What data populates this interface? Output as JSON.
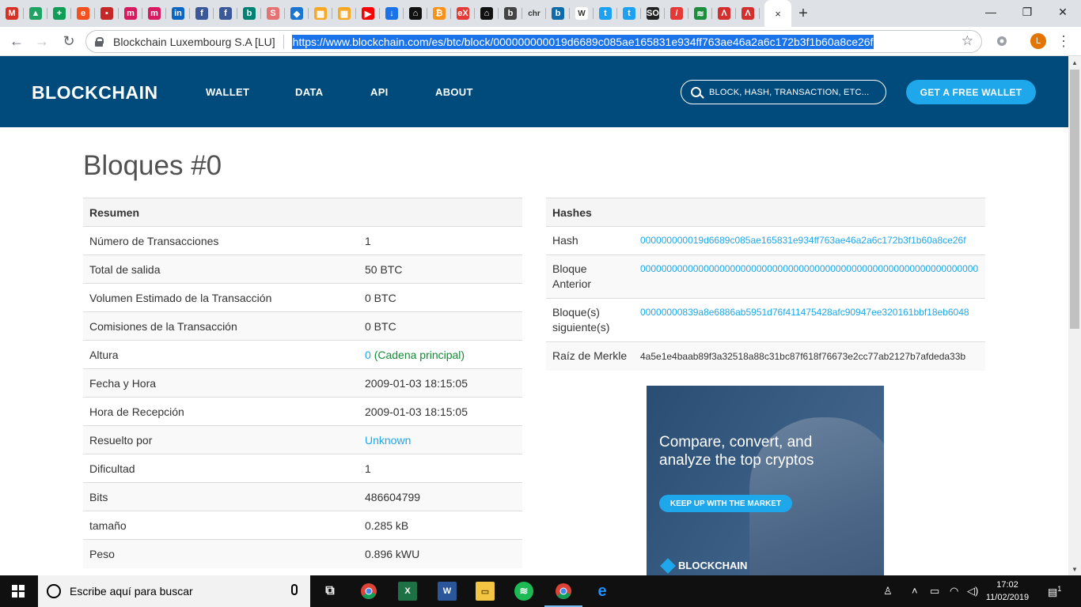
{
  "browser": {
    "active_tab_close": "×",
    "new_tab": "+",
    "site_identity": "Blockchain Luxembourg S.A [LU]",
    "url": "https://www.blockchain.com/es/btc/block/000000000019d6689c085ae165831e934ff763ae46a2a6c172b3f1b60a8ce26f",
    "profile_initial": "L",
    "bookmarks": [
      {
        "icon": "gmail-icon",
        "glyph": "M",
        "color": "#d93025"
      },
      {
        "icon": "drive-icon",
        "glyph": "▲",
        "color": "#1fa463"
      },
      {
        "icon": "sheets-plus-icon",
        "glyph": "+",
        "color": "#0f9d58"
      },
      {
        "icon": "e-icon",
        "glyph": "e",
        "color": "#f4511e"
      },
      {
        "icon": "grid-icon",
        "glyph": "▪",
        "color": "#c62828"
      },
      {
        "icon": "m-icon",
        "glyph": "m",
        "color": "#d81b60"
      },
      {
        "icon": "m-icon-2",
        "glyph": "m",
        "color": "#d81b60"
      },
      {
        "icon": "linkedin-icon",
        "glyph": "in",
        "color": "#0a66c2"
      },
      {
        "icon": "facebook-icon",
        "glyph": "f",
        "color": "#3b5998"
      },
      {
        "icon": "facebook-icon-2",
        "glyph": "f",
        "color": "#3b5998"
      },
      {
        "icon": "bing-icon",
        "glyph": "b",
        "color": "#008373"
      },
      {
        "icon": "s-icon",
        "glyph": "S",
        "color": "#e57373"
      },
      {
        "icon": "diamond-icon",
        "glyph": "◆",
        "color": "#1976d2"
      },
      {
        "icon": "table-icon",
        "glyph": "▦",
        "color": "#f9a825"
      },
      {
        "icon": "table-icon-2",
        "glyph": "▦",
        "color": "#f9a825"
      },
      {
        "icon": "youtube-icon",
        "glyph": "▶",
        "color": "#ff0000"
      },
      {
        "icon": "download-icon",
        "glyph": "↓",
        "color": "#1a73e8"
      },
      {
        "icon": "house-icon",
        "glyph": "⌂",
        "color": "#111111"
      },
      {
        "icon": "bitcoin-icon",
        "glyph": "₿",
        "color": "#f7931a"
      },
      {
        "icon": "xe-icon",
        "glyph": "eX",
        "color": "#e53935"
      },
      {
        "icon": "house-icon-2",
        "glyph": "⌂",
        "color": "#111111"
      },
      {
        "icon": "b-outline-icon",
        "glyph": "b",
        "color": "#444444"
      },
      {
        "icon": "chr-tab",
        "glyph": "chr",
        "color": "#dee1e6"
      },
      {
        "icon": "bing-icon-2",
        "glyph": "b",
        "color": "#0f6ca8"
      },
      {
        "icon": "wikipedia-icon",
        "glyph": "W",
        "color": "#ffffff"
      },
      {
        "icon": "twitter-icon",
        "glyph": "t",
        "color": "#1da1f2"
      },
      {
        "icon": "twitter-icon-2",
        "glyph": "t",
        "color": "#1da1f2"
      },
      {
        "icon": "so-icon",
        "glyph": "SO",
        "color": "#222222"
      },
      {
        "icon": "slash-icon",
        "glyph": "/",
        "color": "#e53935"
      },
      {
        "icon": "wifi-shield-icon",
        "glyph": "≋",
        "color": "#1e8e3e"
      },
      {
        "icon": "acrobat-icon",
        "glyph": "Λ",
        "color": "#d32f2f"
      },
      {
        "icon": "acrobat-icon-2",
        "glyph": "Λ",
        "color": "#d32f2f"
      }
    ]
  },
  "header": {
    "logo": "BLOCKCHAIN",
    "nav": [
      "WALLET",
      "DATA",
      "API",
      "ABOUT"
    ],
    "search_placeholder": "BLOCK, HASH, TRANSACTION, ETC...",
    "cta": "GET A FREE WALLET"
  },
  "page_title": "Bloques #0",
  "summary": {
    "heading": "Resumen",
    "rows": [
      {
        "label": "Número de Transacciones",
        "value": "1"
      },
      {
        "label": "Total de salida",
        "value": "50 BTC"
      },
      {
        "label": "Volumen Estimado de la Transacción",
        "value": "0 BTC"
      },
      {
        "label": "Comisiones de la Transacción",
        "value": "0 BTC"
      },
      {
        "label": "Altura",
        "value": "0",
        "value_extra": "(Cadena principal)"
      },
      {
        "label": "Fecha y Hora",
        "value": "2009-01-03 18:15:05"
      },
      {
        "label": "Hora de Recepción",
        "value": "2009-01-03 18:15:05"
      },
      {
        "label": "Resuelto por",
        "value": "Unknown"
      },
      {
        "label": "Dificultad",
        "value": "1"
      },
      {
        "label": "Bits",
        "value": "486604799"
      },
      {
        "label": "tamaño",
        "value": "0.285 kB"
      },
      {
        "label": "Peso",
        "value": "0.896 kWU"
      }
    ]
  },
  "hashes": {
    "heading": "Hashes",
    "rows": [
      {
        "label": "Hash",
        "value": "000000000019d6689c085ae165831e934ff763ae46a2a6c172b3f1b60a8ce26f"
      },
      {
        "label": "Bloque Anterior",
        "value": "0000000000000000000000000000000000000000000000000000000000000000"
      },
      {
        "label": "Bloque(s) siguiente(s)",
        "value": "00000000839a8e6886ab5951d76f411475428afc90947ee320161bbf18eb6048"
      },
      {
        "label": "Raíz de Merkle",
        "value": "4a5e1e4baab89f3a32518a88c31bc87f618f76673e2cc77ab2127b7afdeda33b"
      }
    ]
  },
  "ad": {
    "text": "Compare, convert, and analyze the top cryptos",
    "button": "KEEP UP WITH THE MARKET",
    "logo": "BLOCKCHAIN"
  },
  "taskbar": {
    "search_placeholder": "Escribe aquí para buscar",
    "time": "17:02",
    "date": "11/02/2019",
    "notification_count": "1"
  },
  "colors": {
    "header_bg": "#004a7c",
    "accent": "#1ea7ea",
    "link_green": "#138a36"
  }
}
